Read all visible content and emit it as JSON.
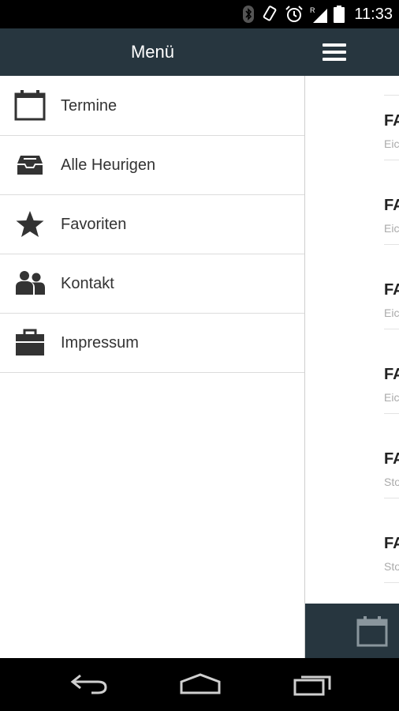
{
  "status_bar": {
    "time": "11:33",
    "icons": [
      "bluetooth-icon",
      "rotate-icon",
      "alarm-icon",
      "signal-icon",
      "battery-icon"
    ]
  },
  "drawer": {
    "title": "Menü",
    "items": [
      {
        "label": "Termine",
        "icon": "calendar-icon"
      },
      {
        "label": "Alle Heurigen",
        "icon": "inbox-icon"
      },
      {
        "label": "Favoriten",
        "icon": "star-icon"
      },
      {
        "label": "Kontakt",
        "icon": "people-icon"
      },
      {
        "label": "Impressum",
        "icon": "briefcase-icon"
      }
    ]
  },
  "content": {
    "header_icon": "menu-icon",
    "list": [
      {
        "title": "FA",
        "subtitle": "Eic"
      },
      {
        "title": "FA",
        "subtitle": "Eic"
      },
      {
        "title": "FA",
        "subtitle": "Eic"
      },
      {
        "title": "FA",
        "subtitle": "Eic"
      },
      {
        "title": "FA",
        "subtitle": "Sto"
      },
      {
        "title": "FA",
        "subtitle": "Sto"
      }
    ],
    "footer_icon": "calendar-icon"
  },
  "nav_bar": {
    "buttons": [
      "back-icon",
      "home-icon",
      "recent-apps-icon"
    ]
  },
  "colors": {
    "header": "#27363f",
    "text": "#333333",
    "divider": "#dcdcdc"
  }
}
